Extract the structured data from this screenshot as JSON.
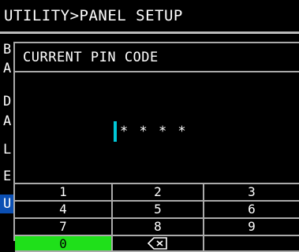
{
  "header": {
    "title": "UTILITY>PANEL SETUP"
  },
  "background_menu": {
    "letters": [
      "B",
      "A",
      "D",
      "A",
      "L",
      "E",
      "U"
    ],
    "selected_index": 6
  },
  "dialog": {
    "title": "CURRENT PIN CODE",
    "pin_display": "* * * *",
    "keypad": {
      "keys": [
        "1",
        "2",
        "3",
        "4",
        "5",
        "6",
        "7",
        "8",
        "9",
        "0"
      ],
      "backspace_icon": "backspace-icon",
      "highlighted_key": "0",
      "highlight_color": "#1fe01a"
    },
    "cursor_color": "#00c8d8"
  },
  "colors": {
    "selection": "#0b4fb3",
    "background": "#000000",
    "text": "#ffffff"
  }
}
